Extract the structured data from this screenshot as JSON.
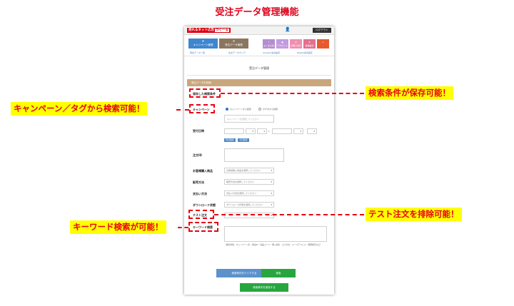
{
  "heading": "受注データ管理機能",
  "app": {
    "logo": "売れるネット広告",
    "logo_badge": "つくーる",
    "logout": "ログアウト"
  },
  "nav": {
    "campaign": "キャンペーン管理",
    "order": "受注データ管理",
    "utilities": [
      "よくある質問",
      "アカウント",
      "お問い合わせ",
      "各種設定",
      ""
    ]
  },
  "subnav": [
    "受注データ一覧",
    "注文データクリア",
    "Amazon決済設定",
    "PayPal決済設定"
  ],
  "page_title": "受注データ管理",
  "section_title": "受注データを検索",
  "form": {
    "saved_conditions_label": "保存した検索条件",
    "campaign_label": "キャンペーン",
    "radio_campaign": "キャンペーンから検索",
    "radio_tag": "タグIDから検索",
    "campaign_placeholder": "キャンペーンを選択してください",
    "date_label": "受付日時",
    "date_sep": "〜",
    "today_btn": "昨日検索",
    "yesterday_btn": "今日検索",
    "order_id_label": "注文ID",
    "product_label": "お客様購入商品",
    "product_select": "お客様購入商品を選択してください",
    "sales_label": "販売方法",
    "sales_select": "販売方法を選択してください",
    "payment_label": "支払い方法",
    "payment_select": "支払い方法を選択してください",
    "download_label": "ダウンロード状態",
    "download_select": "ダウンロード状態を選択してください",
    "test_label": "テスト注文",
    "keyword_label": "キーワード検索",
    "keyword_note": "（検索対象：キャンペーン名・受注ID・商品コード・購入者名・ふりがな・メールアドレス・郵便番号など）",
    "clear_btn": "検索条件をクリアする",
    "search_btn": "検索",
    "save_btn": "検索条件を保存する"
  },
  "annotations": {
    "save_conditions": "検索条件が保存可能！",
    "campaign_tag": "キャンペーン／タグから検索可能！",
    "test_exclude": "テスト注文を排除可能！",
    "keyword": "キーワード検索が可能！"
  },
  "colors": {
    "accent_red": "#e60012",
    "highlight": "#ffff00"
  }
}
